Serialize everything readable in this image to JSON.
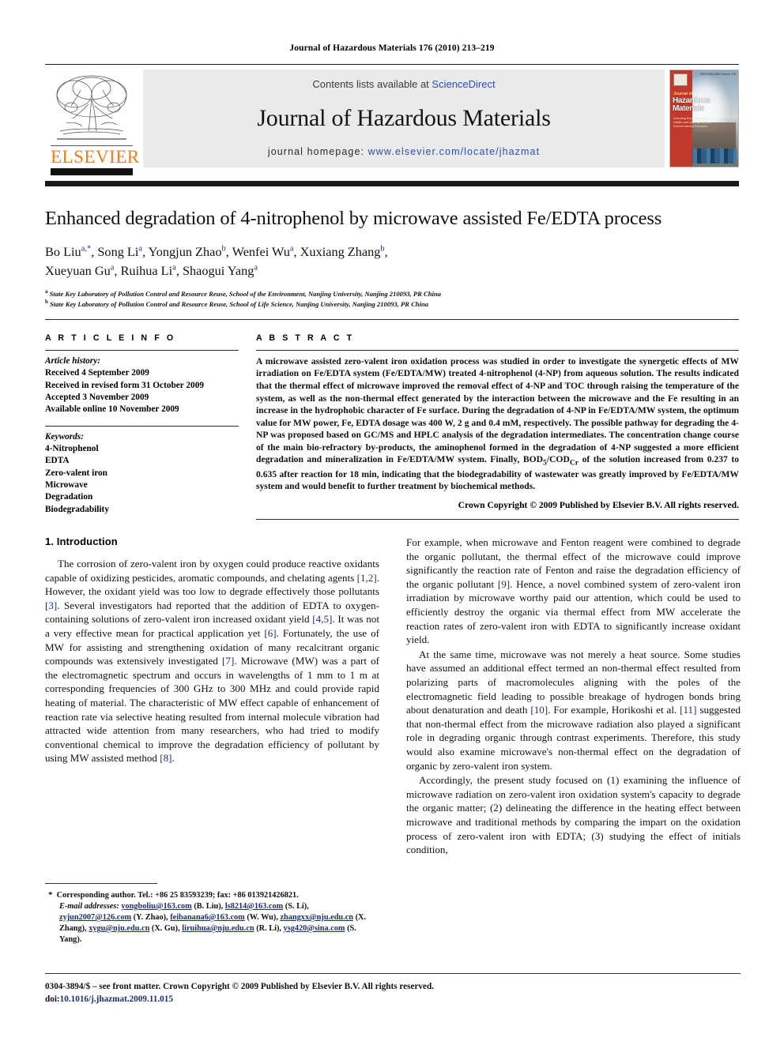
{
  "running_head": "Journal of Hazardous Materials 176 (2010) 213–219",
  "masthead": {
    "contents_prefix": "Contents lists available at ",
    "contents_link": "ScienceDirect",
    "journal_title": "Journal of Hazardous Materials",
    "homepage_prefix": "journal homepage: ",
    "homepage_url": "www.elsevier.com/locate/jhazmat",
    "publisher_logo_text": "ELSEVIER",
    "cover": {
      "line_jof": "Journal of",
      "line_title_1": "Hazardous",
      "line_title_2": "Materials",
      "subtitle": "Including Environmental Health and Management of Environmental Solutions",
      "corner_note": "ISSN 0304-3894 Volume 176"
    }
  },
  "article": {
    "title": "Enhanced degradation of 4-nitrophenol by microwave assisted Fe/EDTA process",
    "authors_line_1_parts": [
      {
        "name": "Bo Liu",
        "sup": "a,",
        "star": true
      },
      {
        "name": "Song Li",
        "sup": "a"
      },
      {
        "name": "Yongjun Zhao",
        "sup": "b"
      },
      {
        "name": "Wenfei Wu",
        "sup": "a"
      },
      {
        "name": "Xuxiang Zhang",
        "sup": "b"
      }
    ],
    "authors_line_2_parts": [
      {
        "name": "Xueyuan Gu",
        "sup": "a"
      },
      {
        "name": "Ruihua Li",
        "sup": "a"
      },
      {
        "name": "Shaogui Yang",
        "sup": "a"
      }
    ],
    "affiliations": [
      {
        "marker": "a",
        "text": "State Key Laboratory of Pollution Control and Resource Reuse, School of the Environment, Nanjing University, Nanjing 210093, PR China"
      },
      {
        "marker": "b",
        "text": "State Key Laboratory of Pollution Control and Resource Reuse, School of Life Science, Nanjing University, Nanjing 210093, PR China"
      }
    ]
  },
  "article_info": {
    "heading": "A R T I C L E    I N F O",
    "history_label": "Article history:",
    "history": [
      "Received 4 September 2009",
      "Received in revised form 31 October 2009",
      "Accepted 3 November 2009",
      "Available online 10 November 2009"
    ],
    "keywords_label": "Keywords:",
    "keywords": [
      "4-Nitrophenol",
      "EDTA",
      "Zero-valent iron",
      "Microwave",
      "Degradation",
      "Biodegradability"
    ]
  },
  "abstract": {
    "heading": "A B S T R A C T",
    "text_part_1": "A microwave assisted zero-valent iron oxidation process was studied in order to investigate the synergetic effects of MW irradiation on Fe/EDTA system (Fe/EDTA/MW) treated 4-nitrophenol (4-NP) from aqueous solution. The results indicated that the thermal effect of microwave improved the removal effect of 4-NP and TOC through raising the temperature of the system, as well as the non-thermal effect generated by the interaction between the microwave and the Fe resulting in an increase in the hydrophobic character of Fe surface. During the degradation of 4-NP in Fe/EDTA/MW system, the optimum value for MW power, Fe, EDTA dosage was 400 W, 2 g and 0.4 mM, respectively. The possible pathway for degrading the 4-NP was proposed based on GC/MS and HPLC analysis of the degradation intermediates. The concentration change course of the main bio-refractory by-products, the aminophenol formed in the degradation of 4-NP suggested a more efficient degradation and mineralization in Fe/EDTA/MW system. Finally, BOD",
    "sub_1": "5",
    "text_part_2": "/COD",
    "sub_2": "Cr",
    "text_part_3": " of the solution increased from 0.237 to 0.635 after reaction for 18 min, indicating that the biodegradability of wastewater was greatly improved by Fe/EDTA/MW system and would benefit to further treatment by biochemical methods.",
    "copyright": "Crown Copyright © 2009 Published by Elsevier B.V. All rights reserved."
  },
  "body": {
    "section_heading": "1.  Introduction",
    "left_p1_a": "The corrosion of zero-valent iron by oxygen could produce reactive oxidants capable of oxidizing pesticides, aromatic compounds, and chelating agents ",
    "left_p1_r1": "[1,2]",
    "left_p1_b": ". However, the oxidant yield was too low to degrade effectively those pollutants ",
    "left_p1_r2": "[3]",
    "left_p1_c": ". Several investigators had reported that the addition of EDTA to oxygen-containing solutions of zero-valent iron increased oxidant yield ",
    "left_p1_r3": "[4,5]",
    "left_p1_d": ". It was not a very effective mean for practical application yet ",
    "left_p1_r4": "[6]",
    "left_p1_e": ". Fortunately, the use of MW for assisting and strengthening oxidation of many recalcitrant organic compounds was extensively investigated ",
    "left_p1_r5": "[7]",
    "left_p1_f": ". Microwave (MW) was a part of the electromagnetic spectrum and occurs in wavelengths of 1 mm to 1 m at corresponding frequencies of 300 GHz to 300 MHz and could provide rapid heating of material. The characteristic of MW effect capable of enhancement of reaction rate via selective heating resulted from internal molecule vibration had attracted wide attention from many researchers, who had tried to modify conventional chemical to improve the degradation efficiency of pollutant by using MW assisted method ",
    "left_p1_r6": "[8]",
    "left_p1_g": ".",
    "right_p1_a": "For example, when microwave and Fenton reagent were combined to degrade the organic pollutant, the thermal effect of the microwave could improve significantly the reaction rate of Fenton and raise the degradation efficiency of the organic pollutant ",
    "right_p1_r1": "[9]",
    "right_p1_b": ". Hence, a novel combined system of zero-valent iron irradiation by microwave worthy paid our attention, which could be used to efficiently destroy the organic via thermal effect from MW accelerate the reaction rates of zero-valent iron with EDTA to significantly increase oxidant yield.",
    "right_p2_a": "At the same time, microwave was not merely a heat source. Some studies have assumed an additional effect termed an non-thermal effect resulted from polarizing parts of macromolecules aligning with the poles of the electromagnetic field leading to possible breakage of hydrogen bonds bring about denaturation and death ",
    "right_p2_r1": "[10]",
    "right_p2_b": ". For example, Horikoshi et al. ",
    "right_p2_r2": "[11]",
    "right_p2_c": " suggested that non-thermal effect from the microwave radiation also played a significant role in degrading organic through contrast experiments. Therefore, this study would also examine microwave's non-thermal effect on the degradation of organic by zero-valent iron system.",
    "right_p3": "Accordingly, the present study focused on (1) examining the influence of microwave radiation on zero-valent iron oxidation system's capacity to degrade the organic matter; (2) delineating the difference in the heating effect between microwave and traditional methods by comparing the impart on the oxidation process of zero-valent iron with EDTA; (3) studying the effect of initials condition,"
  },
  "footnote": {
    "star": "*",
    "corresponding": "Corresponding author. Tel.: +86 25 83593239; fax: +86 013921426821.",
    "email_label": "E-mail addresses:",
    "emails": [
      {
        "addr": "yongboliu@163.com",
        "who": " (B. Liu), "
      },
      {
        "addr": "ls8214@163.com",
        "who": " (S. Li), "
      },
      {
        "addr": "zyjun2007@126.com",
        "who": " (Y. Zhao), "
      },
      {
        "addr": "feibanana6@163.com",
        "who": " (W. Wu), "
      },
      {
        "addr": "zhangxx@nju.edu.cn",
        "who": " (X. Zhang), "
      },
      {
        "addr": "xygu@nju.edu.cn",
        "who": " (X. Gu), "
      },
      {
        "addr": "liruihua@nju.edu.cn",
        "who": " (R. Li), "
      },
      {
        "addr": "ysg420@sina.com",
        "who": " (S. Yang)."
      }
    ]
  },
  "imprint": {
    "line1": "0304-3894/$ – see front matter. Crown Copyright © 2009 Published by Elsevier B.V. All rights reserved.",
    "doi_label": "doi:",
    "doi_value": "10.1016/j.jhazmat.2009.11.015"
  }
}
